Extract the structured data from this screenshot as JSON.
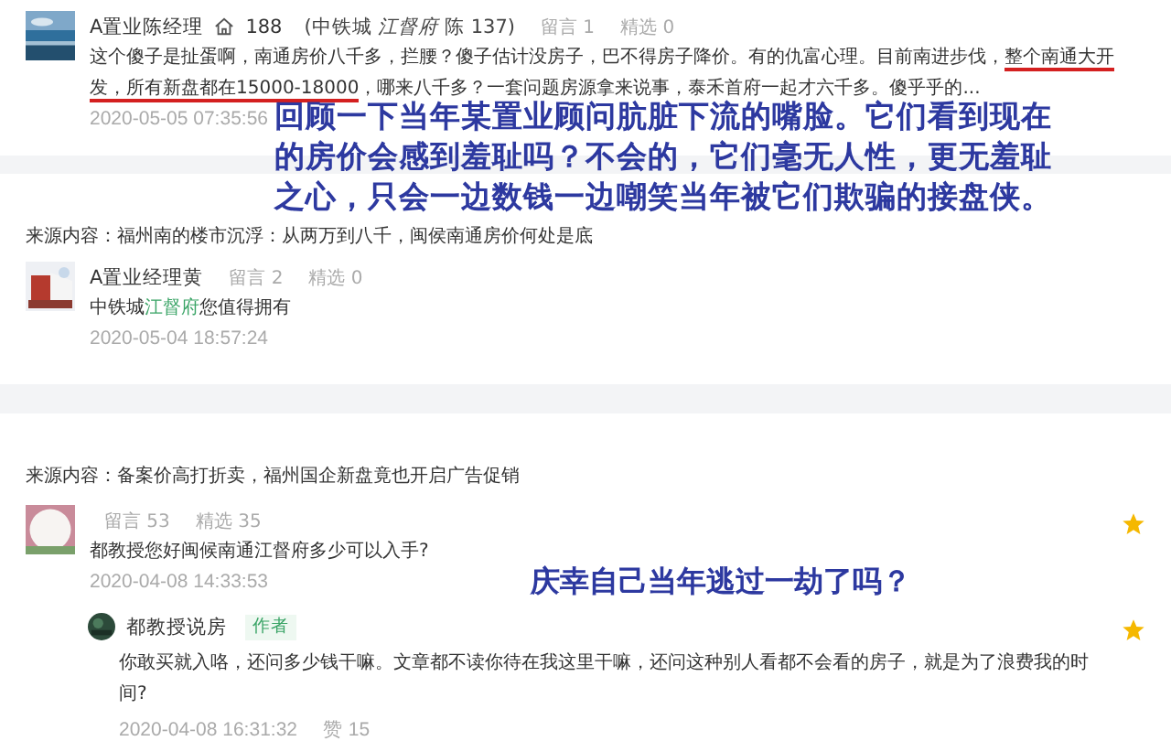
{
  "threads": [
    {
      "comment": {
        "name": "A置业陈经理",
        "house_icon": true,
        "contact": "188",
        "affiliation": "(中铁城 *江督府* 陈 137)",
        "stats": [
          "留言 1",
          "精选 0"
        ],
        "starred": false,
        "text": [
          {
            "kind": "plain",
            "text": "这个傻子是扯蛋啊，南通房价八千多，拦腰？傻子估计没房子，巴不得房子降价。有的仇富心理。目前南进步伐，"
          },
          {
            "kind": "underlined",
            "text": "整个南通大开发，所有新盘都在15000-18000"
          },
          {
            "kind": "plain",
            "text": "，哪来八千多？一套问题房源拿来说事，泰禾首府一起才六千多。傻乎乎的..."
          }
        ],
        "date": "2020-05-05 07:35:56"
      },
      "annotation": "回顾一下当年某置业顾问肮脏下流的嘴脸。它们看到现在的房价会感到羞耻吗？不会的，它们毫无人性，更无羞耻之心，只会一边数钱一边嘲笑当年被它们欺骗的接盘侠。"
    },
    {
      "source": "来源内容：福州南的楼市沉浮：从两万到八千，闽侯南通房价何处是底",
      "comment": {
        "name": "A置业经理黄",
        "house_icon": false,
        "stats": [
          "留言 2",
          "精选 0"
        ],
        "starred": false,
        "text": [
          {
            "kind": "plain",
            "text": "中铁城"
          },
          {
            "kind": "link",
            "text": "江督府"
          },
          {
            "kind": "plain",
            "text": "您值得拥有"
          }
        ],
        "date": "2020-05-04 18:57:24"
      }
    },
    {
      "source": "来源内容：备案价高打折卖，福州国企新盘竟也开启广告促销",
      "comment": {
        "house_icon": false,
        "stats": [
          "留言 53",
          "精选 35"
        ],
        "starred": true,
        "text": [
          {
            "kind": "plain",
            "text": "都教授您好闽候南通江督府多少可以入手?"
          }
        ],
        "date": "2020-04-08 14:33:53"
      },
      "annotation": "庆幸自己当年逃过一劫了吗？",
      "reply": {
        "name": "都教授说房",
        "badge": "作者",
        "starred": true,
        "text": "你敢买就入咯，还问多少钱干嘛。文章都不读你待在我这里干嘛，还问这种别人看都不会看的房子，就是为了浪费我的时间?",
        "date": "2020-04-08 16:31:32",
        "likes": "赞 15"
      }
    }
  ]
}
